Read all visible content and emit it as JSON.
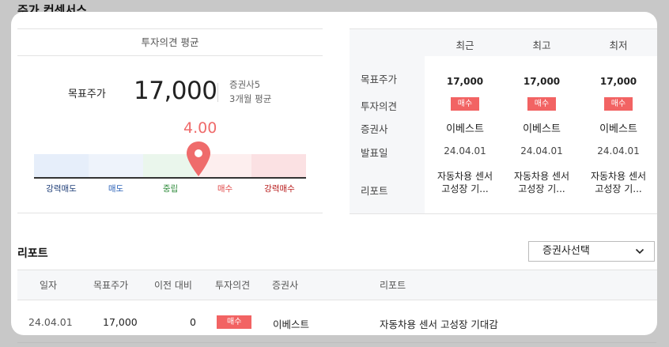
{
  "section_title": "주가 컨센서스",
  "left_panel": {
    "header": "투자의견 평균",
    "target_label": "목표주가",
    "target_price": "17,000",
    "broker_count": "증권사5",
    "period": "3개월 평균",
    "score": "4.00",
    "gauge_labels": [
      "강력매도",
      "매도",
      "중립",
      "매수",
      "강력매수"
    ],
    "gauge_colors": [
      "#1f3e78",
      "#2d63b8",
      "#2e8b3a",
      "#e04848",
      "#b81c1c"
    ],
    "score_value": 4.0
  },
  "right_panel": {
    "row_labels": [
      "목표주가",
      "투자의견",
      "증권사",
      "발표일",
      "리포트"
    ],
    "columns": [
      {
        "header": "최근",
        "price": "17,000",
        "opinion": "매수",
        "broker": "이베스트",
        "date": "24.04.01",
        "report_line1": "자동차용 센서",
        "report_line2": "고성장 기..."
      },
      {
        "header": "최고",
        "price": "17,000",
        "opinion": "매수",
        "broker": "이베스트",
        "date": "24.04.01",
        "report_line1": "자동차용 센서",
        "report_line2": "고성장 기..."
      },
      {
        "header": "최저",
        "price": "17,000",
        "opinion": "매수",
        "broker": "이베스트",
        "date": "24.04.01",
        "report_line1": "자동차용 센서",
        "report_line2": "고성장 기..."
      }
    ]
  },
  "reports": {
    "title": "리포트",
    "select_label": "증권사선택",
    "headers": [
      "일자",
      "목표주가",
      "이전 대비",
      "투자의견",
      "증권사",
      "리포트"
    ],
    "rows": [
      {
        "date": "24.04.01",
        "price": "17,000",
        "change": "0",
        "opinion": "매수",
        "broker": "이베스트",
        "report": "자동차용 센서 고성장 기대감"
      }
    ]
  }
}
